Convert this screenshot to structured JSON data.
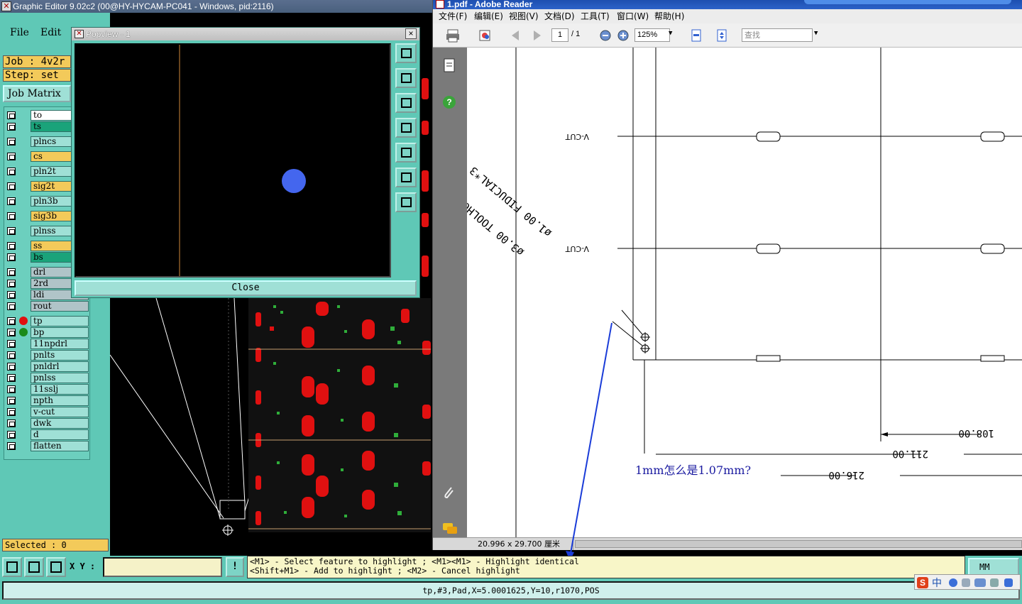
{
  "graphic_editor": {
    "title": "Graphic Editor 9.02c2 (00@HY-HYCAM-PC041 - Windows, pid:2116)",
    "menu": [
      "File",
      "Edit"
    ],
    "job": "Job : 4v2r",
    "step": "Step: set",
    "job_matrix": "Job Matrix",
    "layers": [
      {
        "name": "to",
        "color": "#ffffff"
      },
      {
        "name": "ts",
        "color": "#1aa37a"
      },
      {
        "name": "plncs",
        "color": "#9fe0d6"
      },
      {
        "name": "cs",
        "color": "#f3ca5a"
      },
      {
        "name": "pln2t",
        "color": "#9fe0d6"
      },
      {
        "name": "sig2t",
        "color": "#f3ca5a"
      },
      {
        "name": "pln3b",
        "color": "#9fe0d6"
      },
      {
        "name": "sig3b",
        "color": "#f3ca5a"
      },
      {
        "name": "plnss",
        "color": "#9fe0d6"
      },
      {
        "name": "ss",
        "color": "#f3ca5a"
      },
      {
        "name": "bs",
        "color": "#1aa37a"
      },
      {
        "name": "drl",
        "color": "#b0c4c8"
      },
      {
        "name": "2rd",
        "color": "#b0c4c8"
      },
      {
        "name": "ldi",
        "color": "#b0c4c8"
      },
      {
        "name": "rout",
        "color": "#b0c4c8"
      },
      {
        "name": "tp",
        "color": "#9fe0d6",
        "dot": "#e01010"
      },
      {
        "name": "bp",
        "color": "#9fe0d6",
        "dot": "#1a8a1a"
      },
      {
        "name": "11npdrl",
        "color": "#9fe0d6"
      },
      {
        "name": "pnlts",
        "color": "#9fe0d6"
      },
      {
        "name": "pnldrl",
        "color": "#9fe0d6"
      },
      {
        "name": "pnlss",
        "color": "#9fe0d6"
      },
      {
        "name": "11sslj",
        "color": "#9fe0d6"
      },
      {
        "name": "npth",
        "color": "#9fe0d6"
      },
      {
        "name": "v-cut",
        "color": "#9fe0d6"
      },
      {
        "name": "dwk",
        "color": "#9fe0d6"
      },
      {
        "name": "d",
        "color": "#9fe0d6"
      },
      {
        "name": "flatten",
        "color": "#9fe0d6"
      }
    ],
    "selected": "Selected : 0",
    "popview": {
      "title": "Popview - 1",
      "close_label": "Close",
      "close_x": "×"
    },
    "xy_label": "X Y :",
    "xy_value": "",
    "bang": "!",
    "hint_line1": "<M1> - Select feature to highlight ; <M1><M1> - Highlight identical",
    "hint_line2": "<Shift+M1> - Add to highlight ; <M2> - Cancel highlight",
    "units": "MM",
    "status": "tp,#3,Pad,X=5.0001625,Y=10,r1070,POS"
  },
  "adobe_reader": {
    "title": "1.pdf - Adobe Reader",
    "menu": [
      "文件(F)",
      "编辑(E)",
      "视图(V)",
      "文档(D)",
      "工具(T)",
      "窗口(W)",
      "帮助(H)"
    ],
    "page_current": "1",
    "page_total": "/ 1",
    "zoom": "125%",
    "find_placeholder": "查找",
    "page_size": "20.996 x 29.700 厘米",
    "drawing_labels": {
      "vcut1": "V-CUT",
      "vcut2": "V-CUT",
      "fiducial": "ø1.00  FIDUCIAL*3",
      "toolhole": "ø3.00  TOOLHOLE*3",
      "dim1": "108.00",
      "dim2": "211.00",
      "dim3": "216.00"
    }
  },
  "annotation": "1mm怎么是1.07mm?",
  "tray": {
    "ime": "中"
  }
}
